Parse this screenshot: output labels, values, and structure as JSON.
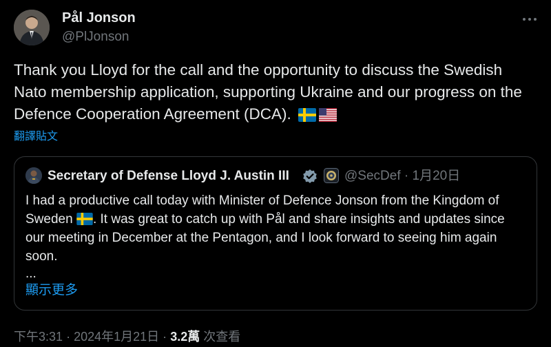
{
  "author": {
    "name": "Pål Jonson",
    "handle": "@PlJonson",
    "avatar_icon": "profile-photo"
  },
  "tweet": {
    "text": "Thank you Lloyd for the call and the opportunity to discuss the Swedish Nato membership application, supporting Ukraine and our progress on the Defence Cooperation Agreement (DCA).",
    "flags": [
      "sweden-flag-icon",
      "usa-flag-icon"
    ],
    "translate_label": "翻譯貼文"
  },
  "quote": {
    "name": "Secretary of Defense Lloyd J. Austin III",
    "handle": "@SecDef",
    "separator": "·",
    "date": "1月20日",
    "text_before_flag": "I had a productive call today with Minister of Defence Jonson from the Kingdom of Sweden",
    "text_after_flag": ". It was great to catch up with Pål and share insights and updates since our meeting in December at the Pentagon, and I look forward to seeing him again soon.",
    "ellipsis": "...",
    "show_more_label": "顯示更多"
  },
  "meta": {
    "time": "下午3:31",
    "separator": "·",
    "date": "2024年1月21日",
    "views_count": "3.2萬",
    "views_label": "次查看"
  },
  "colors": {
    "background": "#000000",
    "text": "#e7e9ea",
    "secondary": "#71767b",
    "link": "#1d9bf0",
    "border": "#333639",
    "verified_badge": "#829aab"
  }
}
